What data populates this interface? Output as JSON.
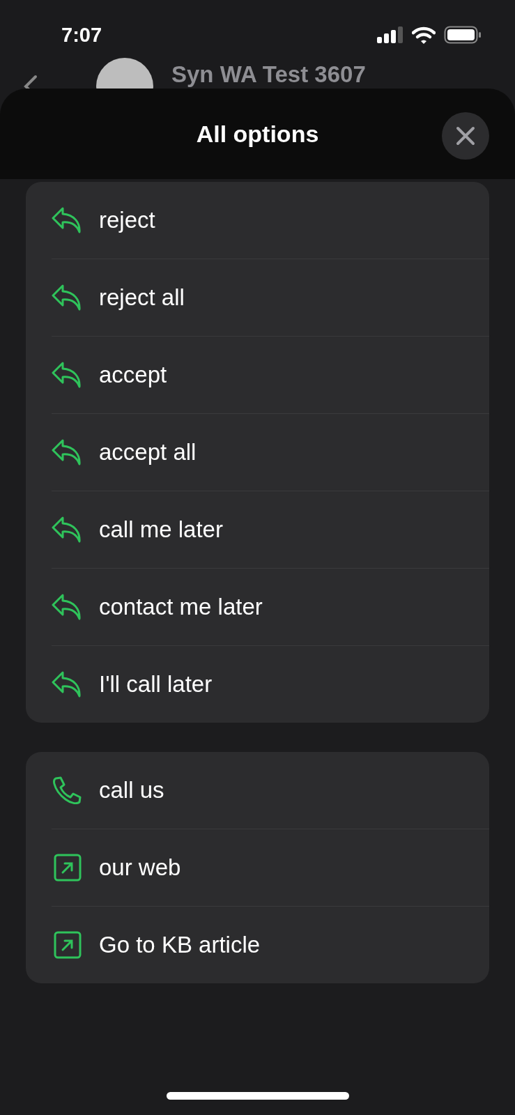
{
  "status_bar": {
    "time": "7:07"
  },
  "chat_header": {
    "title": "Syn WA Test 3607"
  },
  "sheet": {
    "title": "All options",
    "groups": [
      {
        "items": [
          {
            "label": "reject",
            "kind": "reply"
          },
          {
            "label": "reject all",
            "kind": "reply"
          },
          {
            "label": "accept",
            "kind": "reply"
          },
          {
            "label": "accept all",
            "kind": "reply"
          },
          {
            "label": "call me later",
            "kind": "reply"
          },
          {
            "label": "contact me later",
            "kind": "reply"
          },
          {
            "label": "I'll call later",
            "kind": "reply"
          }
        ]
      },
      {
        "items": [
          {
            "label": "call us",
            "kind": "call"
          },
          {
            "label": "our web",
            "kind": "link"
          },
          {
            "label": "Go to KB article",
            "kind": "link"
          }
        ]
      }
    ]
  }
}
